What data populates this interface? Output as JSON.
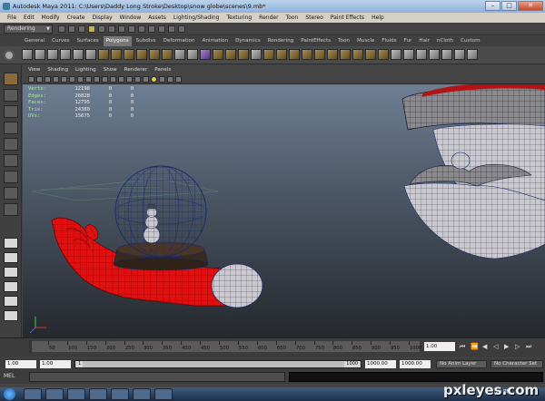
{
  "window": {
    "title": "Autodesk Maya 2011: C:\\Users\\Daddy Long Stroke\\Desktop\\snow globe\\scenes\\9.mb*"
  },
  "menubar": [
    "File",
    "Edit",
    "Modify",
    "Create",
    "Display",
    "Window",
    "Assets",
    "Lighting/Shading",
    "Texturing",
    "Render",
    "Toon",
    "Stereo",
    "Paint Effects",
    "Help"
  ],
  "statusline": {
    "mode": "Rendering"
  },
  "shelf": {
    "tabs": [
      "General",
      "Curves",
      "Surfaces",
      "Polygons",
      "Subdivs",
      "Deformation",
      "Animation",
      "Dynamics",
      "Rendering",
      "PaintEffects",
      "Toon",
      "Muscle",
      "Fluids",
      "Fur",
      "Hair",
      "nCloth",
      "Custom"
    ],
    "active_tab": "Polygons"
  },
  "panel": {
    "menus": [
      "View",
      "Shading",
      "Lighting",
      "Show",
      "Renderer",
      "Panels"
    ]
  },
  "hud": {
    "rows": [
      {
        "label": "Verts:",
        "value": "12198",
        "sel": "0",
        "comp": "0"
      },
      {
        "label": "Edges:",
        "value": "26828",
        "sel": "0",
        "comp": "0"
      },
      {
        "label": "Faces:",
        "value": "12795",
        "sel": "0",
        "comp": "0"
      },
      {
        "label": "Tris:",
        "value": "24380",
        "sel": "0",
        "comp": "0"
      },
      {
        "label": "UVs:",
        "value": "15675",
        "sel": "0",
        "comp": "0"
      }
    ]
  },
  "timeline": {
    "ticks": [
      "1",
      "50",
      "100",
      "150",
      "200",
      "250",
      "300",
      "350",
      "400",
      "450",
      "500",
      "550",
      "600",
      "650",
      "700",
      "750",
      "800",
      "850",
      "900",
      "950",
      "1000"
    ],
    "current_frame": "1.00"
  },
  "range": {
    "start": "1.00",
    "inner_start": "1.00",
    "range_in": "1",
    "range_out": "1000",
    "end_a": "1000.00",
    "end_b": "1000.00",
    "anim_layer": "No Anim Layer",
    "char_set": "No Character Set"
  },
  "cmdline": {
    "label": "MEL"
  },
  "taskbar": {
    "time": "9:23 PM"
  },
  "watermark": "pxleyes.com",
  "colors": {
    "hand": "#e01010",
    "viewport_top": "#6e7f93",
    "viewport_bottom": "#25282d",
    "wire": "#1a2a6a"
  }
}
